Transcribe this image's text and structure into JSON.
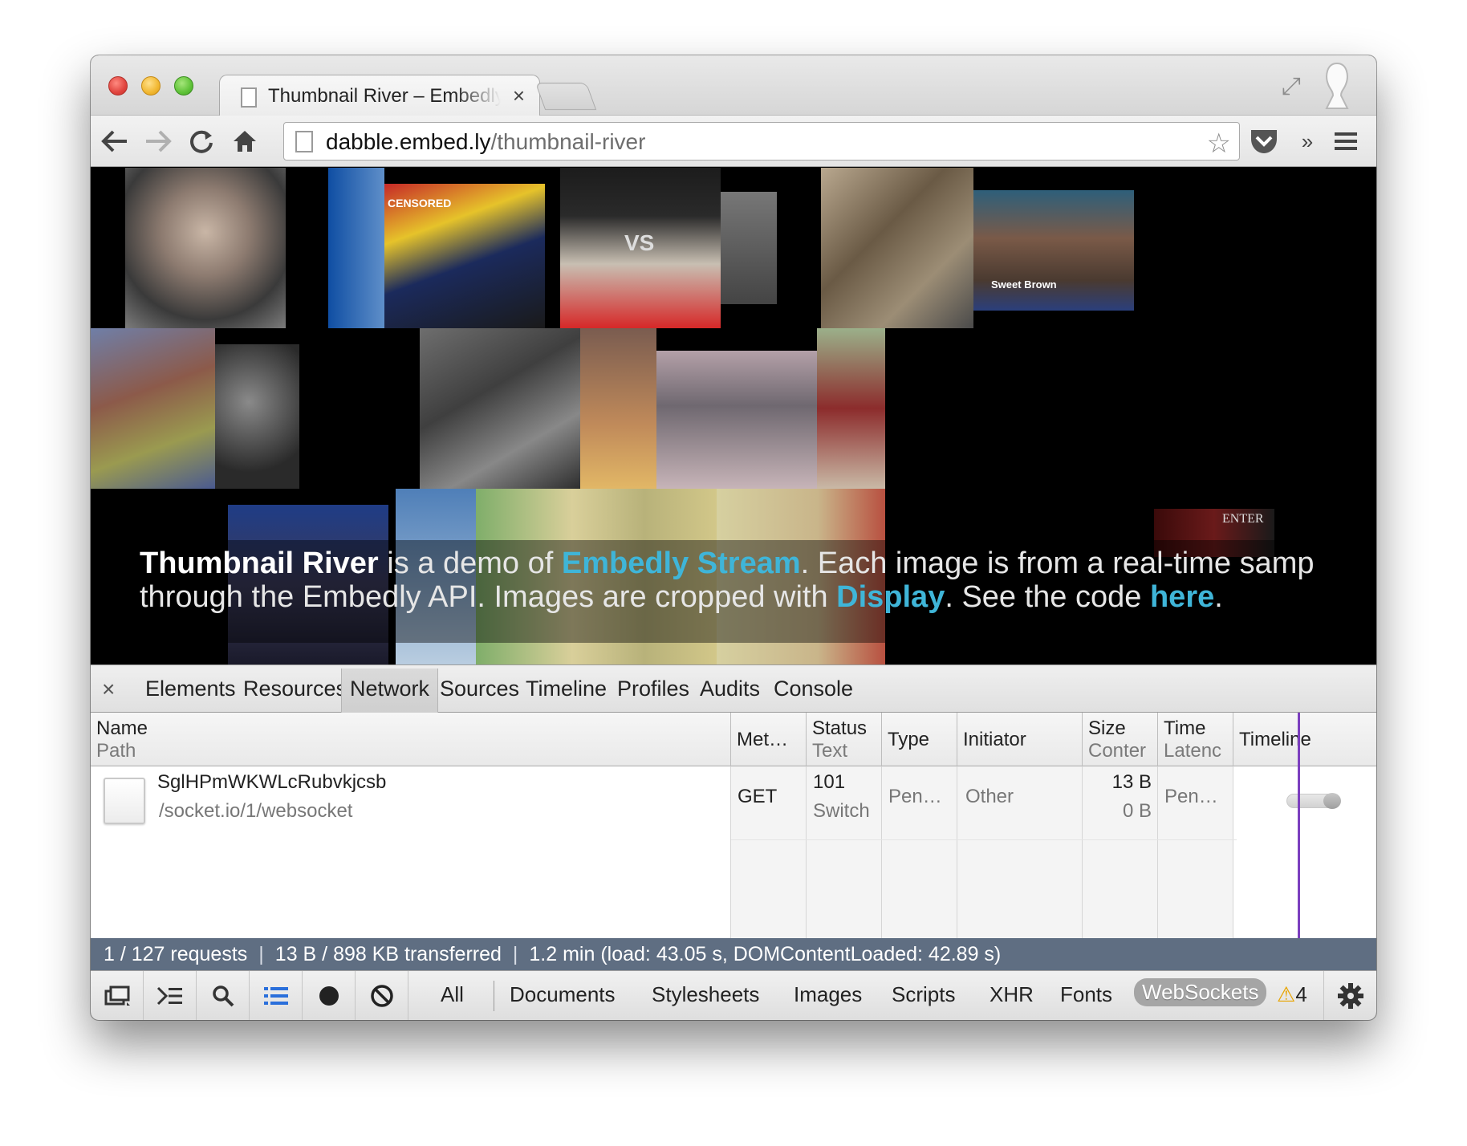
{
  "tab": {
    "title": "Thumbnail River – Embedly",
    "close_glyph": "×"
  },
  "omnibox": {
    "host": "dabble.embed.ly",
    "path": "/thumbnail-river"
  },
  "page": {
    "caption": {
      "part1_bold": "Thumbnail River",
      "part2": " is a demo of ",
      "link1": "Embedly Stream",
      "part3": ". Each image is from a real-time samp",
      "line2_a": "through the Embedly API. Images are cropped with ",
      "link2": "Display",
      "line2_b": ". See the code ",
      "link3": "here",
      "line2_c": "."
    },
    "tile_texts": {
      "sweet_brown": "Sweet Brown",
      "censored": "CENSORED",
      "vs": "VS",
      "enter": "ENTER"
    }
  },
  "devtools": {
    "close_glyph": "×",
    "tabs": [
      "Elements",
      "Resources",
      "Network",
      "Sources",
      "Timeline",
      "Profiles",
      "Audits",
      "Console"
    ],
    "active_tab": "Network",
    "columns": {
      "name": {
        "top": "Name",
        "sub": "Path"
      },
      "method": {
        "top": "Met…"
      },
      "status": {
        "top": "Status",
        "sub": "Text"
      },
      "type": {
        "top": "Type"
      },
      "initiator": {
        "top": "Initiator"
      },
      "size": {
        "top": "Size",
        "sub": "Conter"
      },
      "time": {
        "top": "Time",
        "sub": "Latenc"
      },
      "timeline": {
        "top": "Timeline"
      }
    },
    "request": {
      "name": "SglHPmWKWLcRubvkjcsb",
      "path": "/socket.io/1/websocket",
      "method": "GET",
      "status": "101",
      "status_text": "Switch",
      "type": "Pen…",
      "initiator": "Other",
      "size": "13 B",
      "content": "0 B",
      "time": "Pen…"
    },
    "summary": {
      "requests": "1 / 127 requests",
      "transferred": "13 B / 898 KB transferred",
      "timing": "1.2 min (load: 43.05 s, DOMContentLoaded: 42.89 s)",
      "separator": "|"
    },
    "filters": [
      "All",
      "Documents",
      "Stylesheets",
      "Images",
      "Scripts",
      "XHR",
      "Fonts",
      "WebSockets"
    ],
    "active_filter": "WebSockets",
    "warnings_count": "4",
    "warning_glyph": "⚠"
  },
  "colors": {
    "link": "#3fb5d8",
    "summary_bar": "#5f6e82",
    "dom_line": "#7c3fbf"
  }
}
